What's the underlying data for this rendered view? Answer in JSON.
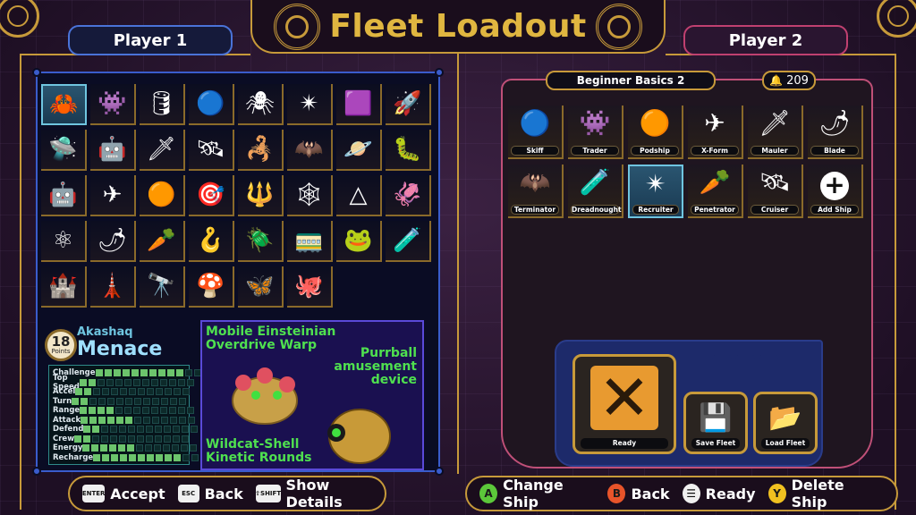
{
  "title": "Fleet Loadout",
  "players": {
    "p1": "Player 1",
    "p2": "Player 2"
  },
  "roster": [
    {
      "icon": "🦀",
      "selected": true
    },
    {
      "icon": "👾"
    },
    {
      "icon": "🛢"
    },
    {
      "icon": "🔵"
    },
    {
      "icon": "🕷"
    },
    {
      "icon": "✴"
    },
    {
      "icon": "🟪"
    },
    {
      "icon": "🚀"
    },
    {
      "icon": "🛸"
    },
    {
      "icon": "🤖"
    },
    {
      "icon": "🗡"
    },
    {
      "icon": "🛰"
    },
    {
      "icon": "🦂"
    },
    {
      "icon": "🦇"
    },
    {
      "icon": "🪐"
    },
    {
      "icon": "🐛"
    },
    {
      "icon": "🤖"
    },
    {
      "icon": "✈"
    },
    {
      "icon": "🟠"
    },
    {
      "icon": "🎯"
    },
    {
      "icon": "🔱"
    },
    {
      "icon": "🕸"
    },
    {
      "icon": "△"
    },
    {
      "icon": "🦑"
    },
    {
      "icon": "⚛"
    },
    {
      "icon": "🌶"
    },
    {
      "icon": "🥕"
    },
    {
      "icon": "🪝"
    },
    {
      "icon": "🪲"
    },
    {
      "icon": "🚃"
    },
    {
      "icon": "🐸"
    },
    {
      "icon": "🧪"
    },
    {
      "icon": "🏰"
    },
    {
      "icon": "🗼"
    },
    {
      "icon": "🔭"
    },
    {
      "icon": "🍄"
    },
    {
      "icon": "🦋"
    },
    {
      "icon": "🐙"
    }
  ],
  "selected_ship": {
    "points": "18",
    "points_label": "Points",
    "class": "Akashaq",
    "name": "Menace",
    "stats": [
      {
        "label": "Challenge",
        "value": 10
      },
      {
        "label": "Top Speed",
        "value": 2
      },
      {
        "label": "Accel",
        "value": 2
      },
      {
        "label": "Turn",
        "value": 2
      },
      {
        "label": "Range",
        "value": 4
      },
      {
        "label": "Attack",
        "value": 6
      },
      {
        "label": "Defend",
        "value": 2
      },
      {
        "label": "Crew",
        "value": 2
      },
      {
        "label": "Energy",
        "value": 6
      },
      {
        "label": "Recharge",
        "value": 10
      }
    ],
    "stat_max": 13,
    "descriptions": {
      "primary": "Mobile Einsteinian Overdrive Warp",
      "secondary": "Purrball amusement device",
      "weapon": "Wildcat-Shell Kinetic Rounds"
    }
  },
  "fleet": {
    "name": "Beginner Basics 2",
    "points": "209",
    "ships": [
      {
        "icon": "🔵",
        "label": "Skiff"
      },
      {
        "icon": "👾",
        "label": "Trader"
      },
      {
        "icon": "🟠",
        "label": "Podship"
      },
      {
        "icon": "✈",
        "label": "X-Form"
      },
      {
        "icon": "🗡",
        "label": "Mauler"
      },
      {
        "icon": "🌶",
        "label": "Blade"
      },
      {
        "icon": "🦇",
        "label": "Terminator"
      },
      {
        "icon": "🧪",
        "label": "Dreadnought"
      },
      {
        "icon": "✴",
        "label": "Recruiter",
        "selected": true
      },
      {
        "icon": "🥕",
        "label": "Penetrator"
      },
      {
        "icon": "🛰",
        "label": "Cruiser"
      }
    ],
    "add_label": "Add Ship"
  },
  "actions": {
    "ready": "Ready",
    "save": "Save Fleet",
    "load": "Load Fleet"
  },
  "hints_left": [
    {
      "key": "ENTER",
      "text": "Accept"
    },
    {
      "key": "ESC",
      "text": "Back"
    },
    {
      "key": "⇧SHIFT",
      "text": "Show Details"
    }
  ],
  "hints_right": [
    {
      "button": "A",
      "color": "#5cc83a",
      "text": "Change Ship"
    },
    {
      "button": "B",
      "color": "#e8542a",
      "text": "Back"
    },
    {
      "button": "☰",
      "color": "#f0f0f0",
      "text": "Ready"
    },
    {
      "button": "Y",
      "color": "#f0c020",
      "text": "Delete Ship"
    }
  ]
}
